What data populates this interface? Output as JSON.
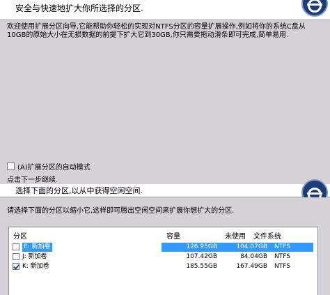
{
  "top": {
    "header_text": "安全与快速地扩大你所选择的分区.",
    "intro": "欢迎使用扩展分区向导,它能帮助你轻松的实现对NTFS分区的容量扩展操作,例如将你的系统C盘从10GB的原始大小在无损数据的前提下扩大它到30GB,你只需要拖动滑条即可完成,简单易用.",
    "auto_mode_label": "(A)扩展分区的自动模式",
    "auto_mode_checked": false,
    "next_hint": "点击下一步继续."
  },
  "bottom": {
    "header_text": "选择下面的分区,以从中获得空闲空间.",
    "instruction": "请选择下面的分区以缩小它,这样即可腾出空闲空间来扩展你想扩大的分区.",
    "columns": {
      "partition": "分区",
      "capacity": "容量",
      "unused": "未使用",
      "filesystem": "文件系统"
    },
    "rows": [
      {
        "checked": false,
        "selected": true,
        "name": "E: 新加卷",
        "capacity": "126.95GB",
        "unused": "104.07GB",
        "fs": "NTFS"
      },
      {
        "checked": false,
        "selected": false,
        "name": "J: 新加卷",
        "capacity": "107.42GB",
        "unused": "84.04GB",
        "fs": "NTFS"
      },
      {
        "checked": true,
        "selected": false,
        "name": "K: 新加卷",
        "capacity": "185.55GB",
        "unused": "167.49GB",
        "fs": "NTFS"
      }
    ]
  },
  "colors": {
    "panel_bg": "#d4d2d6",
    "selection": "#3399ff",
    "logo": "#1e3d78"
  }
}
